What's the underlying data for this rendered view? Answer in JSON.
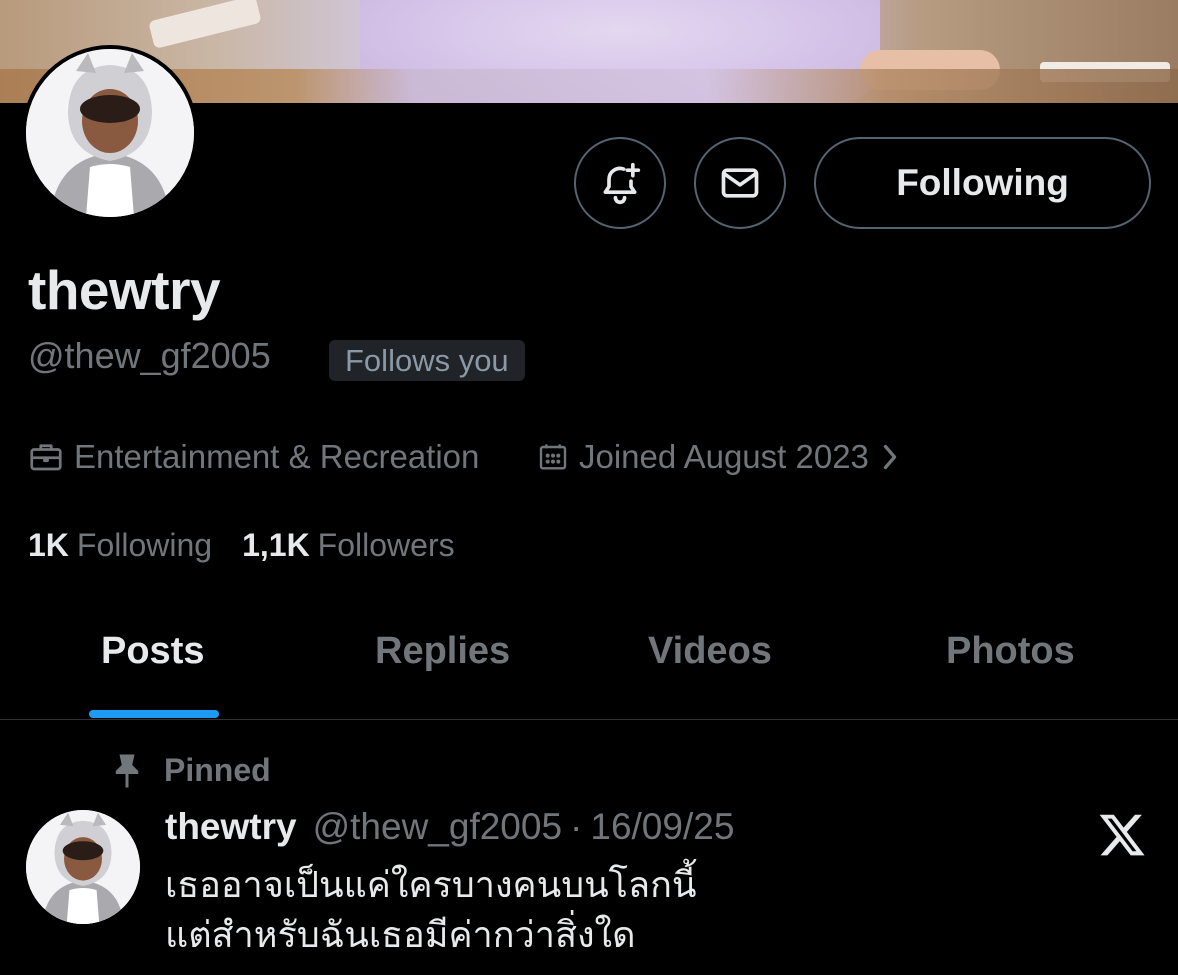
{
  "profile": {
    "display_name": "thewtry",
    "handle": "@thew_gf2005",
    "follows_you_badge": "Follows you",
    "category": "Entertainment & Recreation",
    "joined": "Joined August 2023"
  },
  "actions": {
    "follow_label": "Following"
  },
  "stats": {
    "following_count": "1K",
    "following_label": "Following",
    "followers_count": "1,1K",
    "followers_label": "Followers"
  },
  "tabs": [
    {
      "label": "Posts",
      "active": true
    },
    {
      "label": "Replies",
      "active": false
    },
    {
      "label": "Videos",
      "active": false
    },
    {
      "label": "Photos",
      "active": false
    }
  ],
  "pinned_post": {
    "pinned_label": "Pinned",
    "author_name": "thewtry",
    "author_handle": "@thew_gf2005",
    "separator": "·",
    "date": "16/09/25",
    "lines": [
      "เธออาจเป็นแค่ใครบางคนบนโลกนี้",
      "แต่สำหรับฉันเธอมีค่ากว่าสิ่งใด"
    ]
  },
  "colors": {
    "background": "#000000",
    "text_primary": "#e7e9ea",
    "text_secondary": "#71767b",
    "accent": "#1d9bf0",
    "border": "#536471"
  }
}
